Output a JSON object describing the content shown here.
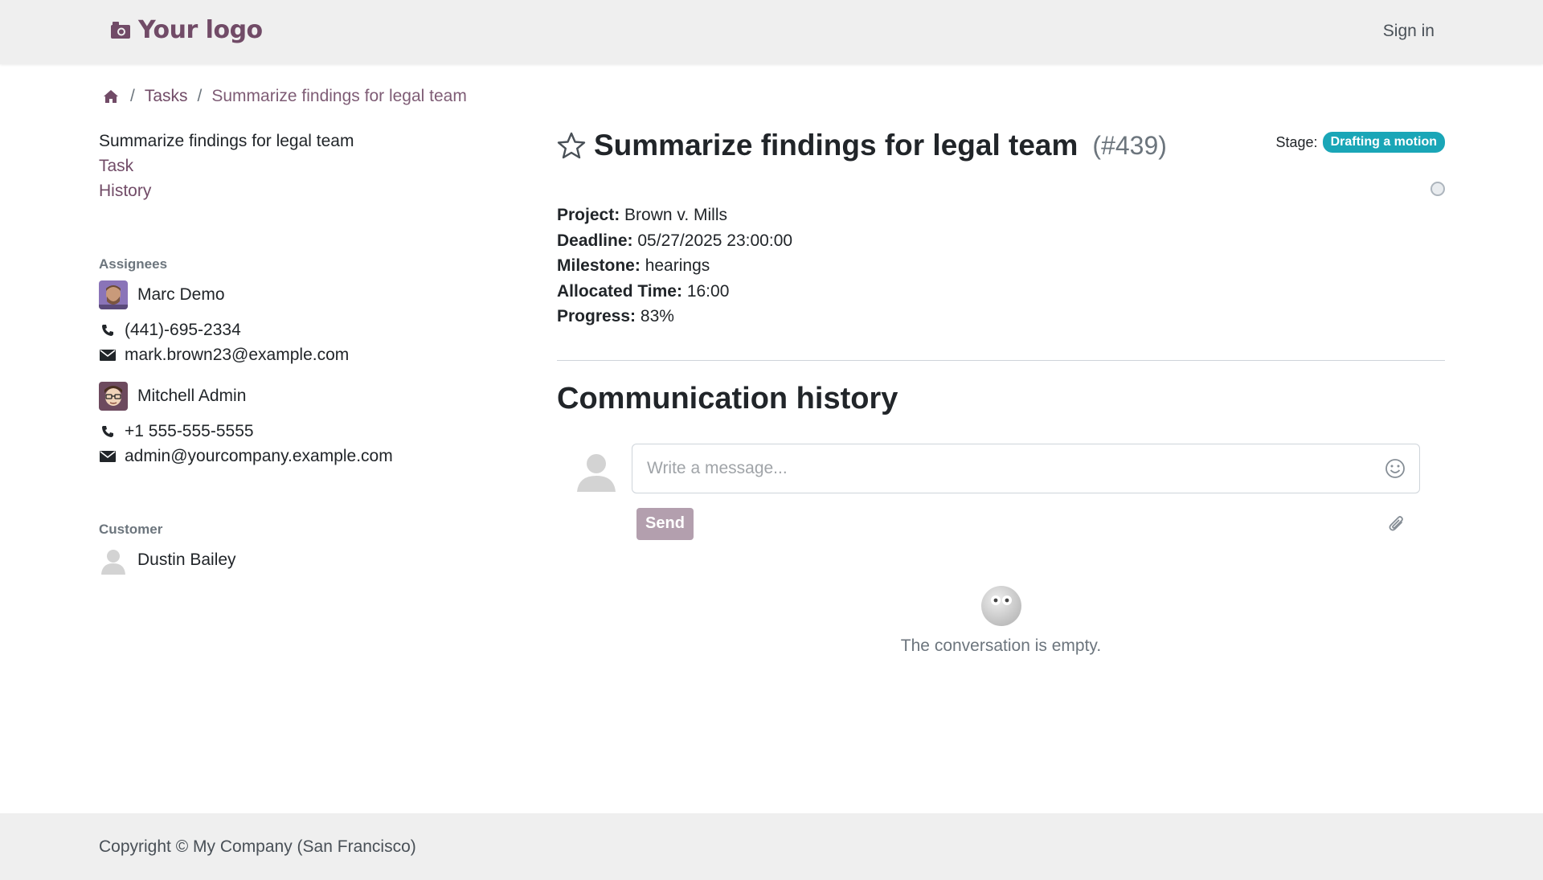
{
  "header": {
    "logo_text": "Your logo",
    "signin_label": "Sign in"
  },
  "breadcrumb": {
    "items": [
      "Tasks",
      "Summarize findings for legal team"
    ]
  },
  "sidebar": {
    "title": "Summarize findings for legal team",
    "links": [
      "Task",
      "History"
    ],
    "assignees_label": "Assignees",
    "assignees": [
      {
        "name": "Marc Demo",
        "phone": "(441)-695-2334",
        "email": "mark.brown23@example.com"
      },
      {
        "name": "Mitchell Admin",
        "phone": "+1 555-555-5555",
        "email": "admin@yourcompany.example.com"
      }
    ],
    "customer_label": "Customer",
    "customer": {
      "name": "Dustin Bailey"
    }
  },
  "task": {
    "title": "Summarize findings for legal team",
    "ref": "(#439)",
    "stage_label": "Stage:",
    "stage": "Drafting a motion",
    "fields": [
      {
        "label": "Project:",
        "value": "Brown v. Mills"
      },
      {
        "label": "Deadline:",
        "value": "05/27/2025 23:00:00"
      },
      {
        "label": "Milestone:",
        "value": "hearings"
      },
      {
        "label": "Allocated Time:",
        "value": "16:00"
      },
      {
        "label": "Progress:",
        "value": "83%"
      }
    ]
  },
  "communication": {
    "title": "Communication history",
    "placeholder": "Write a message...",
    "send_label": "Send",
    "empty_text": "The conversation is empty."
  },
  "footer": {
    "copyright": "Copyright © My Company (San Francisco)"
  },
  "colors": {
    "brand": "#714B67",
    "stage_badge": "#1aa6b7",
    "send_disabled": "#b39fae"
  }
}
